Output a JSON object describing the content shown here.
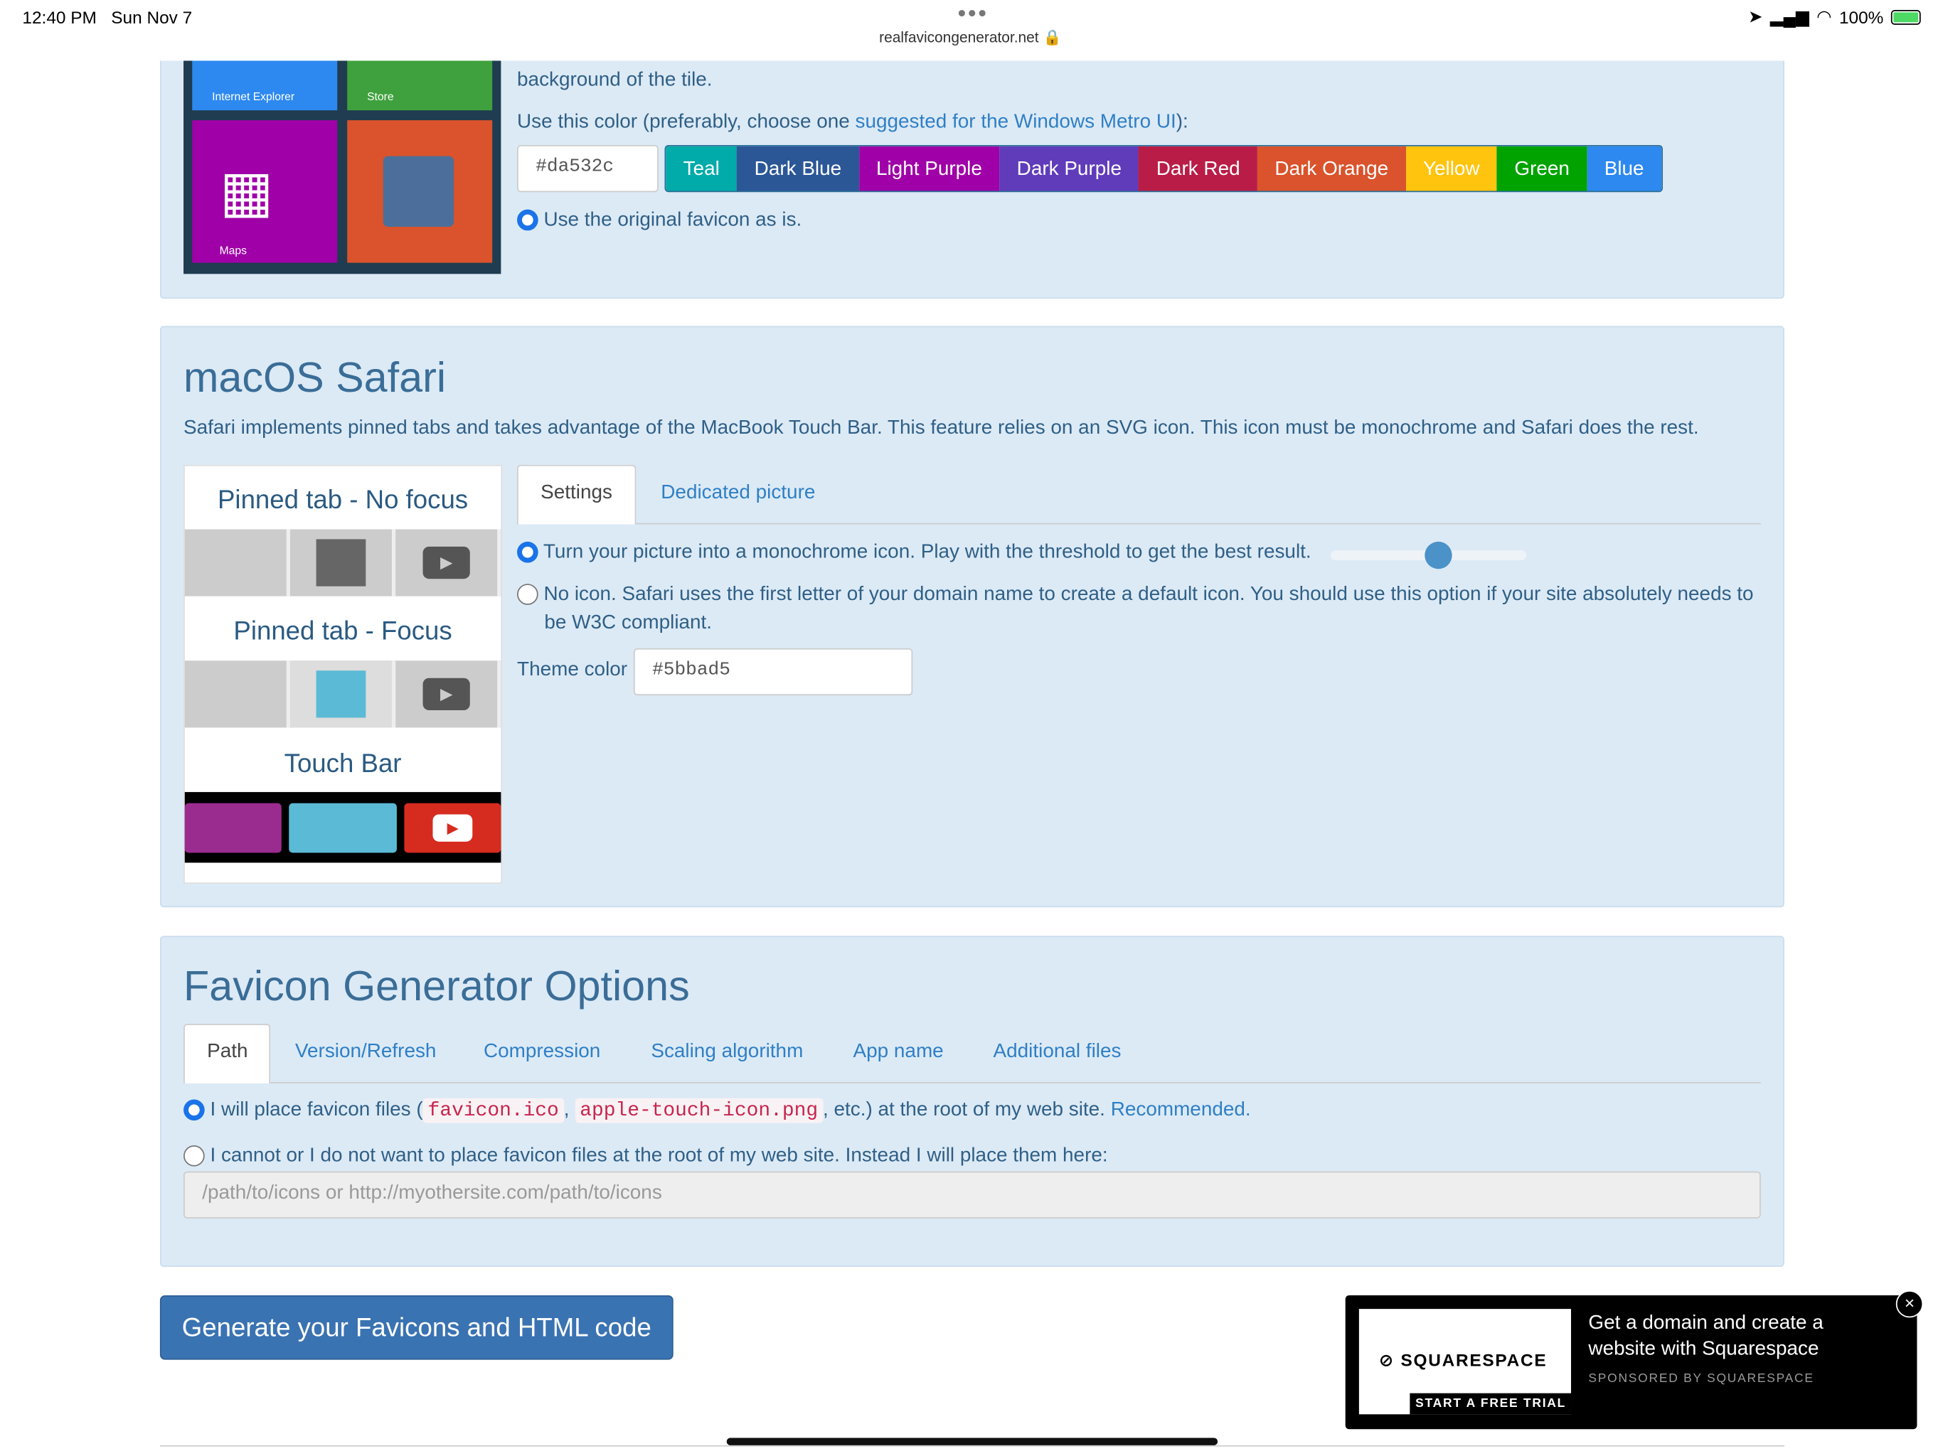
{
  "status": {
    "time": "12:40 PM",
    "date": "Sun Nov 7",
    "url": "realfavicongenerator.net",
    "battery": "100%"
  },
  "windows": {
    "tiles": [
      "Internet Explorer",
      "Store",
      "Maps"
    ],
    "bg_text": "background of the tile.",
    "color_prompt_prefix": "Use this color (preferably, choose one ",
    "color_prompt_link": "suggested for the Windows Metro UI",
    "color_prompt_suffix": "):",
    "color_value": "#da532c",
    "colors": [
      {
        "label": "Teal",
        "hex": "#00aba9"
      },
      {
        "label": "Dark Blue",
        "hex": "#2b5797"
      },
      {
        "label": "Light Purple",
        "hex": "#9f00a7"
      },
      {
        "label": "Dark Purple",
        "hex": "#603cba"
      },
      {
        "label": "Dark Red",
        "hex": "#b91d47"
      },
      {
        "label": "Dark Orange",
        "hex": "#da532c"
      },
      {
        "label": "Yellow",
        "hex": "#ffc40d"
      },
      {
        "label": "Green",
        "hex": "#00a300"
      },
      {
        "label": "Blue",
        "hex": "#2d89ef"
      }
    ],
    "original_option": "Use the original favicon as is."
  },
  "safari": {
    "title": "macOS Safari",
    "desc": "Safari implements pinned tabs and takes advantage of the MacBook Touch Bar. This feature relies on an SVG icon. This icon must be monochrome and Safari does the rest.",
    "preview": {
      "no_focus": "Pinned tab - No focus",
      "focus": "Pinned tab - Focus",
      "touch_bar": "Touch Bar"
    },
    "tabs": [
      "Settings",
      "Dedicated picture"
    ],
    "option1": "Turn your picture into a monochrome icon. Play with the threshold to get the best result.",
    "option2": "No icon. Safari uses the first letter of your domain name to create a default icon. You should use this option if your site absolutely needs to be W3C compliant.",
    "threshold": 0.55,
    "theme_label": "Theme color",
    "theme_value": "#5bbad5"
  },
  "options": {
    "title": "Favicon Generator Options",
    "tabs": [
      "Path",
      "Version/Refresh",
      "Compression",
      "Scaling algorithm",
      "App name",
      "Additional files"
    ],
    "root_prefix": "I will place favicon files (",
    "file1": "favicon.ico",
    "file2": "apple-touch-icon.png",
    "root_suffix": ", etc.) at the root of my web site.",
    "recommended": "Recommended.",
    "other_option": "I cannot or I do not want to place favicon files at the root of my web site. Instead I will place them here:",
    "path_placeholder": "/path/to/icons or http://myothersite.com/path/to/icons"
  },
  "generate_label": "Generate your Favicons and HTML code",
  "ad": {
    "brand": "SQUARESPACE",
    "cta": "START A FREE TRIAL",
    "text": "Get a domain and create a website with Squarespace",
    "sponsor": "SPONSORED BY SQUARESPACE",
    "close": "×"
  }
}
